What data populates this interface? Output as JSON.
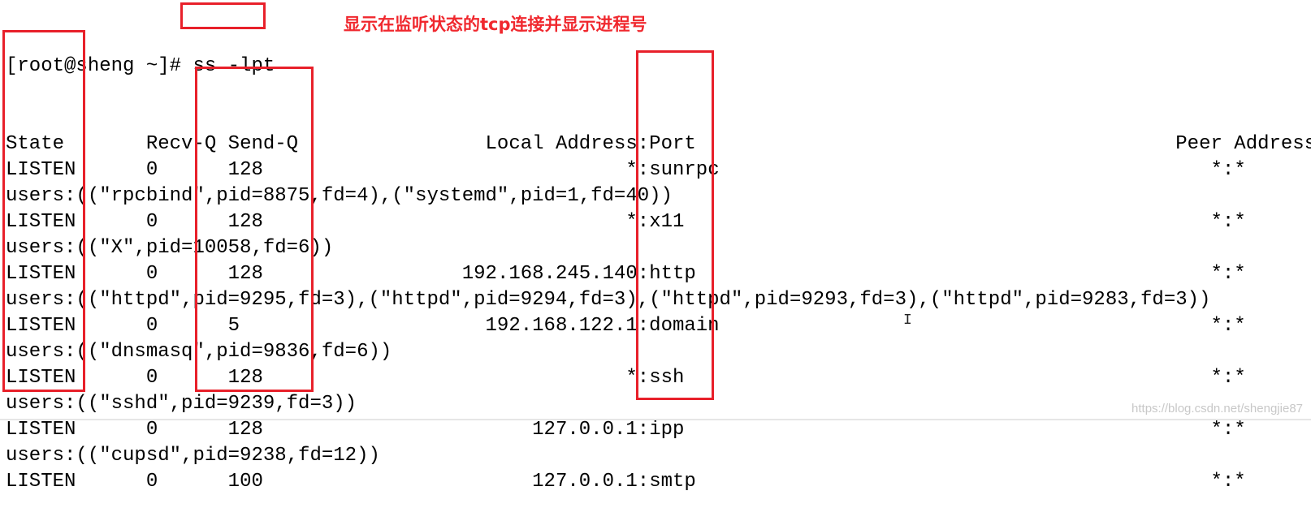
{
  "prompt": "[root@sheng ~]# ",
  "command": "ss -lpt",
  "annotation": "显示在监听状态的tcp连接并显示进程号",
  "header": {
    "state": "State",
    "recvq": "Recv-Q",
    "sendq": "Send-Q",
    "local": "Local Address",
    "local_port": "Port",
    "peer": "Peer Address:Port"
  },
  "rows": [
    {
      "state": "LISTEN",
      "recvq": "0",
      "sendq": "128",
      "local": "*",
      "port": "sunrpc",
      "peer": "*:*",
      "users": "users:((\"rpcbind\",pid=8875,fd=4),(\"systemd\",pid=1,fd=40))"
    },
    {
      "state": "LISTEN",
      "recvq": "0",
      "sendq": "128",
      "local": "*",
      "port": "x11",
      "peer": "*:*",
      "users": "users:((\"X\",pid=10058,fd=6))"
    },
    {
      "state": "LISTEN",
      "recvq": "0",
      "sendq": "128",
      "local": "192.168.245.140",
      "port": "http",
      "peer": "*:*",
      "users": "users:((\"httpd\",pid=9295,fd=3),(\"httpd\",pid=9294,fd=3),(\"httpd\",pid=9293,fd=3),(\"httpd\",pid=9283,fd=3))"
    },
    {
      "state": "LISTEN",
      "recvq": "0",
      "sendq": "5",
      "local": "192.168.122.1",
      "port": "domain",
      "peer": "*:*",
      "users": "users:((\"dnsmasq\",pid=9836,fd=6))"
    },
    {
      "state": "LISTEN",
      "recvq": "0",
      "sendq": "128",
      "local": "*",
      "port": "ssh",
      "peer": "*:*",
      "users": "users:((\"sshd\",pid=9239,fd=3))"
    },
    {
      "state": "LISTEN",
      "recvq": "0",
      "sendq": "128",
      "local": "127.0.0.1",
      "port": "ipp",
      "peer": "*:*",
      "users": "users:((\"cupsd\",pid=9238,fd=12))"
    },
    {
      "state": "LISTEN",
      "recvq": "0",
      "sendq": "100",
      "local": "127.0.0.1",
      "port": "smtp",
      "peer": "*:*"
    }
  ],
  "watermark": "https://blog.csdn.net/shengjie87",
  "highlight_color": "#e8202a"
}
